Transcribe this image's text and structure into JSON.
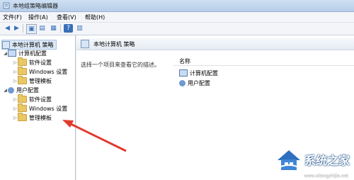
{
  "window": {
    "title": "本地组策略编辑器"
  },
  "menu": [
    {
      "label": "文件(F)"
    },
    {
      "label": "操作(A)"
    },
    {
      "label": "查看(V)"
    },
    {
      "label": "帮助(H)"
    }
  ],
  "tree": {
    "root": "本地计算机 策略",
    "computer_config": "计算机配置",
    "computer_children": [
      "软件设置",
      "Windows 设置",
      "管理模板"
    ],
    "user_config": "用户配置",
    "user_children": [
      "软件设置",
      "Windows 设置",
      "管理模板"
    ]
  },
  "right_panel": {
    "header": "本地计算机 策略",
    "description": "选择一个项目来查看它的描述。",
    "column_name": "名称",
    "items": [
      "计算机配置",
      "用户配置"
    ]
  },
  "watermark": {
    "brand": "系统之家",
    "url": "www.xitongzhijia.net"
  },
  "colors": {
    "arrow": "#e23b2e",
    "accent": "#3a6fb8"
  }
}
